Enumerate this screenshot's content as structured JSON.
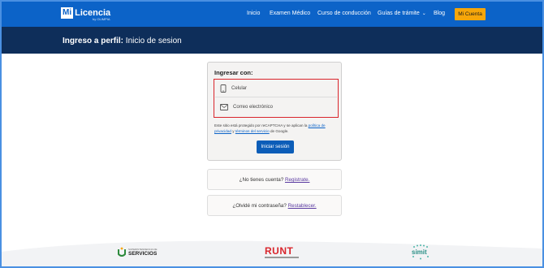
{
  "nav": {
    "logo_box": "Mi",
    "logo_text": "Licencia",
    "logo_sub": "by OLIMPIA",
    "links": [
      "Inicio",
      "Examen Médico",
      "Curso de conducción",
      "Guías de trámite",
      "Blog"
    ],
    "account_label": "Mi Cuenta"
  },
  "title": {
    "bold": "Ingreso a perfil:",
    "rest": "Inicio de sesion"
  },
  "login": {
    "heading": "Ingresar con:",
    "option_phone": "Celular",
    "option_email": "Correo electrónico",
    "captcha_text_1": "Este sitio está protegido por reCAPTCHA y se aplican la",
    "privacy_link": "política de privacidad",
    "captcha_and": "y",
    "terms_link": "términos del servicio",
    "captcha_text_2": "de Google.",
    "submit_label": "Iniciar sesión"
  },
  "register": {
    "question": "¿No tienes cuenta?",
    "link": "Registrate."
  },
  "reset": {
    "question": "¿Olvidé mi contraseña?",
    "link": "Restablecer."
  },
  "partners": {
    "servicios_line1": "SUPERINTENDENCIA DE",
    "servicios_line2": "SERVICIOS",
    "runt": "RUNT",
    "simit": "simit"
  },
  "colors": {
    "nav_bg": "#0c63c8",
    "title_bg": "#0e2e5a",
    "accent_orange": "#f6a60a",
    "highlight_red": "#d9252c",
    "button_blue": "#0c5db8"
  }
}
